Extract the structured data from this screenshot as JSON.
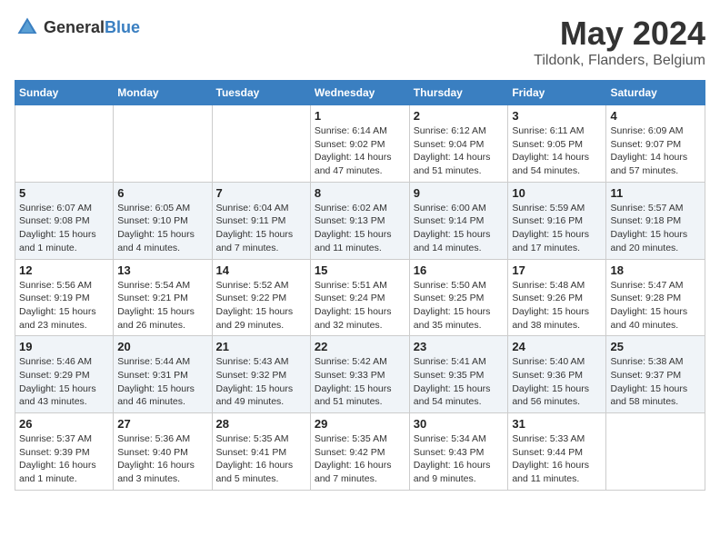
{
  "header": {
    "logo_general": "General",
    "logo_blue": "Blue",
    "main_title": "May 2024",
    "subtitle": "Tildonk, Flanders, Belgium"
  },
  "days_of_week": [
    "Sunday",
    "Monday",
    "Tuesday",
    "Wednesday",
    "Thursday",
    "Friday",
    "Saturday"
  ],
  "weeks": [
    [
      {
        "day": "",
        "info": ""
      },
      {
        "day": "",
        "info": ""
      },
      {
        "day": "",
        "info": ""
      },
      {
        "day": "1",
        "info": "Sunrise: 6:14 AM\nSunset: 9:02 PM\nDaylight: 14 hours\nand 47 minutes."
      },
      {
        "day": "2",
        "info": "Sunrise: 6:12 AM\nSunset: 9:04 PM\nDaylight: 14 hours\nand 51 minutes."
      },
      {
        "day": "3",
        "info": "Sunrise: 6:11 AM\nSunset: 9:05 PM\nDaylight: 14 hours\nand 54 minutes."
      },
      {
        "day": "4",
        "info": "Sunrise: 6:09 AM\nSunset: 9:07 PM\nDaylight: 14 hours\nand 57 minutes."
      }
    ],
    [
      {
        "day": "5",
        "info": "Sunrise: 6:07 AM\nSunset: 9:08 PM\nDaylight: 15 hours\nand 1 minute."
      },
      {
        "day": "6",
        "info": "Sunrise: 6:05 AM\nSunset: 9:10 PM\nDaylight: 15 hours\nand 4 minutes."
      },
      {
        "day": "7",
        "info": "Sunrise: 6:04 AM\nSunset: 9:11 PM\nDaylight: 15 hours\nand 7 minutes."
      },
      {
        "day": "8",
        "info": "Sunrise: 6:02 AM\nSunset: 9:13 PM\nDaylight: 15 hours\nand 11 minutes."
      },
      {
        "day": "9",
        "info": "Sunrise: 6:00 AM\nSunset: 9:14 PM\nDaylight: 15 hours\nand 14 minutes."
      },
      {
        "day": "10",
        "info": "Sunrise: 5:59 AM\nSunset: 9:16 PM\nDaylight: 15 hours\nand 17 minutes."
      },
      {
        "day": "11",
        "info": "Sunrise: 5:57 AM\nSunset: 9:18 PM\nDaylight: 15 hours\nand 20 minutes."
      }
    ],
    [
      {
        "day": "12",
        "info": "Sunrise: 5:56 AM\nSunset: 9:19 PM\nDaylight: 15 hours\nand 23 minutes."
      },
      {
        "day": "13",
        "info": "Sunrise: 5:54 AM\nSunset: 9:21 PM\nDaylight: 15 hours\nand 26 minutes."
      },
      {
        "day": "14",
        "info": "Sunrise: 5:52 AM\nSunset: 9:22 PM\nDaylight: 15 hours\nand 29 minutes."
      },
      {
        "day": "15",
        "info": "Sunrise: 5:51 AM\nSunset: 9:24 PM\nDaylight: 15 hours\nand 32 minutes."
      },
      {
        "day": "16",
        "info": "Sunrise: 5:50 AM\nSunset: 9:25 PM\nDaylight: 15 hours\nand 35 minutes."
      },
      {
        "day": "17",
        "info": "Sunrise: 5:48 AM\nSunset: 9:26 PM\nDaylight: 15 hours\nand 38 minutes."
      },
      {
        "day": "18",
        "info": "Sunrise: 5:47 AM\nSunset: 9:28 PM\nDaylight: 15 hours\nand 40 minutes."
      }
    ],
    [
      {
        "day": "19",
        "info": "Sunrise: 5:46 AM\nSunset: 9:29 PM\nDaylight: 15 hours\nand 43 minutes."
      },
      {
        "day": "20",
        "info": "Sunrise: 5:44 AM\nSunset: 9:31 PM\nDaylight: 15 hours\nand 46 minutes."
      },
      {
        "day": "21",
        "info": "Sunrise: 5:43 AM\nSunset: 9:32 PM\nDaylight: 15 hours\nand 49 minutes."
      },
      {
        "day": "22",
        "info": "Sunrise: 5:42 AM\nSunset: 9:33 PM\nDaylight: 15 hours\nand 51 minutes."
      },
      {
        "day": "23",
        "info": "Sunrise: 5:41 AM\nSunset: 9:35 PM\nDaylight: 15 hours\nand 54 minutes."
      },
      {
        "day": "24",
        "info": "Sunrise: 5:40 AM\nSunset: 9:36 PM\nDaylight: 15 hours\nand 56 minutes."
      },
      {
        "day": "25",
        "info": "Sunrise: 5:38 AM\nSunset: 9:37 PM\nDaylight: 15 hours\nand 58 minutes."
      }
    ],
    [
      {
        "day": "26",
        "info": "Sunrise: 5:37 AM\nSunset: 9:39 PM\nDaylight: 16 hours\nand 1 minute."
      },
      {
        "day": "27",
        "info": "Sunrise: 5:36 AM\nSunset: 9:40 PM\nDaylight: 16 hours\nand 3 minutes."
      },
      {
        "day": "28",
        "info": "Sunrise: 5:35 AM\nSunset: 9:41 PM\nDaylight: 16 hours\nand 5 minutes."
      },
      {
        "day": "29",
        "info": "Sunrise: 5:35 AM\nSunset: 9:42 PM\nDaylight: 16 hours\nand 7 minutes."
      },
      {
        "day": "30",
        "info": "Sunrise: 5:34 AM\nSunset: 9:43 PM\nDaylight: 16 hours\nand 9 minutes."
      },
      {
        "day": "31",
        "info": "Sunrise: 5:33 AM\nSunset: 9:44 PM\nDaylight: 16 hours\nand 11 minutes."
      },
      {
        "day": "",
        "info": ""
      }
    ]
  ]
}
